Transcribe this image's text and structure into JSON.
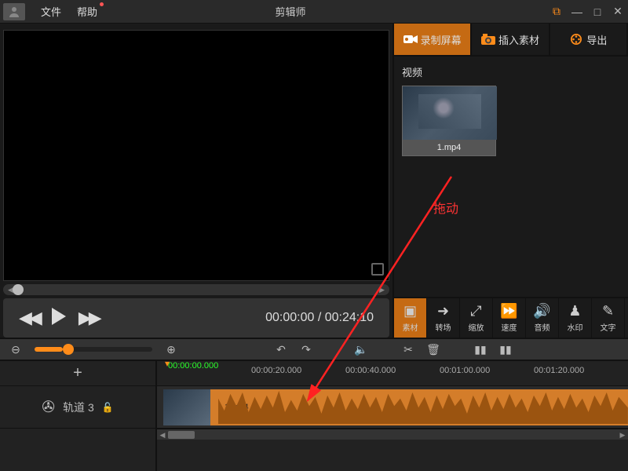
{
  "titlebar": {
    "menu_file": "文件",
    "menu_help": "帮助",
    "app_title": "剪辑师"
  },
  "top_tabs": {
    "record": "录制屏幕",
    "import": "插入素材",
    "export": "导出"
  },
  "asset_panel": {
    "section_label": "视频",
    "items": [
      {
        "name": "1.mp4"
      }
    ],
    "drag_hint": "拖动"
  },
  "mid_tools": {
    "material": "素材",
    "transition": "转场",
    "scale": "缩放",
    "speed": "速度",
    "audio": "音频",
    "watermark": "水印",
    "text": "文字"
  },
  "transport": {
    "timecode": "00:00:00 / 00:24:10"
  },
  "timeline": {
    "playhead_time": "00:00:00.000",
    "ticks": [
      "00:00:20.000",
      "00:00:40.000",
      "00:01:00.000",
      "00:01:20.000"
    ],
    "add_track_symbol": "+",
    "tracks": [
      {
        "name": "轨道 3"
      }
    ],
    "clips": [
      {
        "label": "1.mp4"
      }
    ]
  },
  "icons": {
    "record": "●",
    "camera": "📷",
    "reel": "✇"
  }
}
